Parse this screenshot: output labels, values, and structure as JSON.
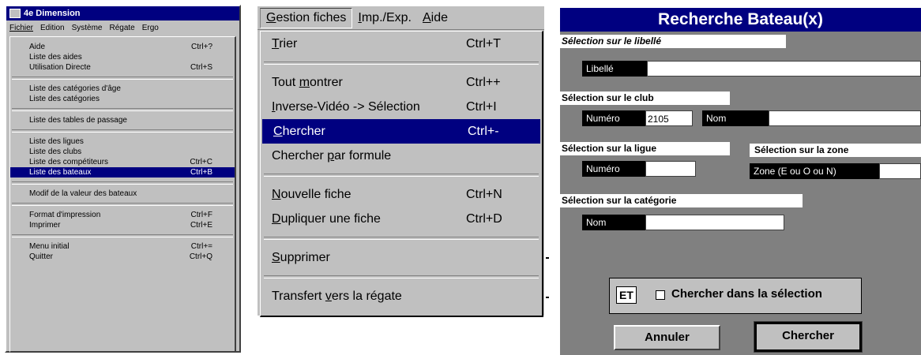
{
  "panel1": {
    "title": "4e Dimension",
    "menubar": [
      "Fichier",
      "Edition",
      "Système",
      "Régate",
      "Ergo"
    ],
    "items": [
      {
        "label": "Aide",
        "shortcut": "Ctrl+?"
      },
      {
        "label": "Liste des aides",
        "shortcut": ""
      },
      {
        "label": "Utilisation Directe",
        "shortcut": "Ctrl+S"
      },
      {
        "sep": true
      },
      {
        "label": "Liste des catégories d'âge",
        "shortcut": ""
      },
      {
        "label": "Liste des catégories",
        "shortcut": ""
      },
      {
        "sep": true
      },
      {
        "label": "Liste des tables de passage",
        "shortcut": ""
      },
      {
        "sep": true
      },
      {
        "label": "Liste des ligues",
        "shortcut": ""
      },
      {
        "label": "Liste des clubs",
        "shortcut": ""
      },
      {
        "label": "Liste des compétiteurs",
        "shortcut": "Ctrl+C"
      },
      {
        "label": "Liste des bateaux",
        "shortcut": "Ctrl+B",
        "highlighted": true
      },
      {
        "sep": true
      },
      {
        "label": "Modif de la valeur des bateaux",
        "shortcut": ""
      },
      {
        "sep": true
      },
      {
        "label": "Format d'impression",
        "shortcut": "Ctrl+F"
      },
      {
        "label": "Imprimer",
        "shortcut": "Ctrl+E"
      },
      {
        "sep": true
      },
      {
        "label": "Menu initial",
        "shortcut": "Ctrl+="
      },
      {
        "label": "Quitter",
        "shortcut": "Ctrl+Q"
      }
    ]
  },
  "panel2": {
    "menubar": [
      {
        "u": "G",
        "rest": "estion fiches",
        "open": true
      },
      {
        "u": "I",
        "rest": "mp./Exp."
      },
      {
        "u": "A",
        "rest": "ide"
      }
    ],
    "items": [
      {
        "pre": "",
        "u": "T",
        "post": "rier",
        "shortcut": "Ctrl+T"
      },
      {
        "sep": true
      },
      {
        "pre": "Tout ",
        "u": "m",
        "post": "ontrer",
        "shortcut": "Ctrl++"
      },
      {
        "pre": "",
        "u": "I",
        "post": "nverse-Vidéo -> Sélection",
        "shortcut": "Ctrl+I"
      },
      {
        "pre": "",
        "u": "C",
        "post": "hercher",
        "shortcut": "Ctrl+-",
        "highlighted": true
      },
      {
        "pre": "Chercher ",
        "u": "p",
        "post": "ar formule",
        "shortcut": ""
      },
      {
        "sep": true
      },
      {
        "pre": "",
        "u": "N",
        "post": "ouvelle fiche",
        "shortcut": "Ctrl+N"
      },
      {
        "pre": "",
        "u": "D",
        "post": "upliquer une fiche",
        "shortcut": "Ctrl+D"
      },
      {
        "sep": true
      },
      {
        "pre": "",
        "u": "S",
        "post": "upprimer",
        "shortcut": ""
      },
      {
        "sep": true
      },
      {
        "pre": "Transfert ",
        "u": "v",
        "post": "ers la régate",
        "shortcut": ""
      }
    ]
  },
  "panel3": {
    "title": "Recherche Bateau(x)",
    "libelle": {
      "header": "Sélection sur le libellé",
      "label": "Libellé",
      "value": ""
    },
    "club": {
      "header": "Sélection sur le club",
      "numero_label": "Numéro",
      "numero_value": "2105",
      "nom_label": "Nom",
      "nom_value": ""
    },
    "ligue": {
      "header": "Sélection sur la ligue",
      "numero_label": "Numéro",
      "numero_value": ""
    },
    "zone": {
      "header": "Sélection sur la zone",
      "label": "Zone (E ou O ou N)",
      "value": ""
    },
    "categorie": {
      "header": "Sélection sur la catégorie",
      "nom_label": "Nom",
      "nom_value": ""
    },
    "et_label": "ET",
    "checkbox_label": "Chercher dans la sélection",
    "checkbox_checked": false,
    "cancel_label": "Annuler",
    "search_label": "Chercher"
  }
}
